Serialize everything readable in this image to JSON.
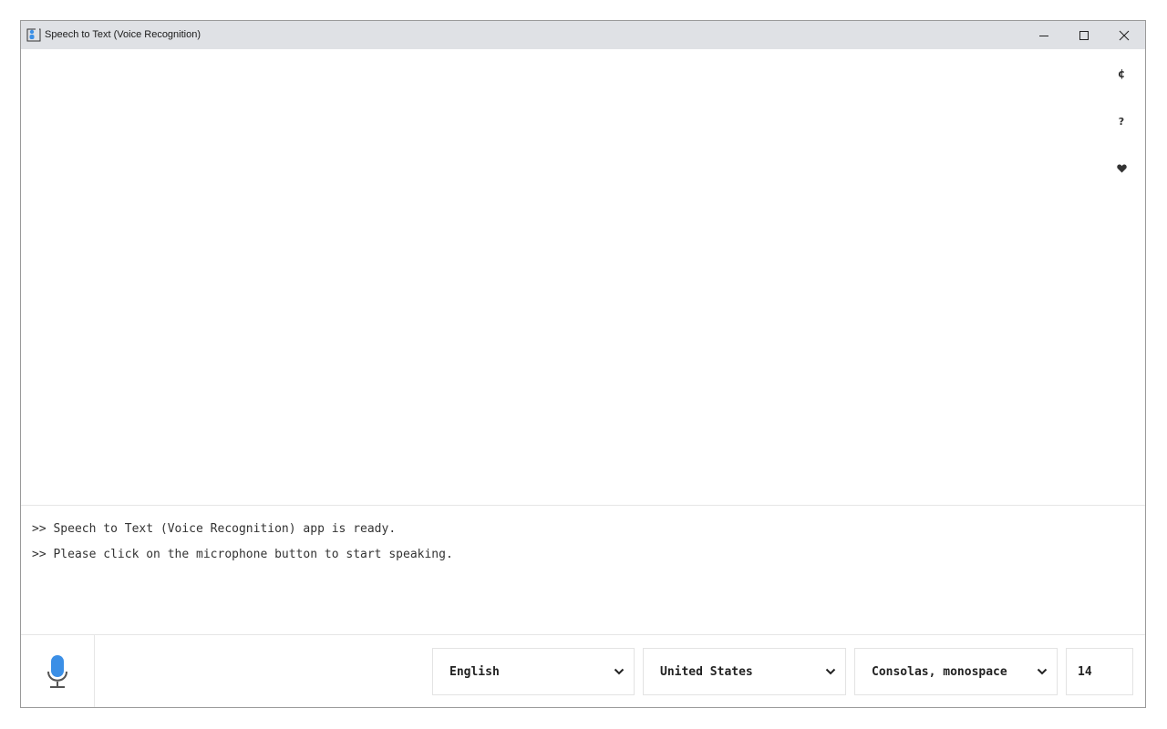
{
  "window": {
    "title": "Speech to Text (Voice Recognition)",
    "controls": [
      "minimize-icon",
      "maximize-icon",
      "close-icon"
    ]
  },
  "editor": {
    "value": "",
    "side_tools": [
      "refresh-icon",
      "help-icon",
      "heart-icon"
    ]
  },
  "log": {
    "lines": [
      ">> Speech to Text (Voice Recognition) app is ready.",
      ">> Please click on the microphone button to start speaking."
    ]
  },
  "toolbar": {
    "mic_icon": "microphone-icon",
    "mic_color": "#3b8fe6",
    "language": "English",
    "country": "United States",
    "font_family": "Consolas, monospace",
    "font_size": "14"
  }
}
